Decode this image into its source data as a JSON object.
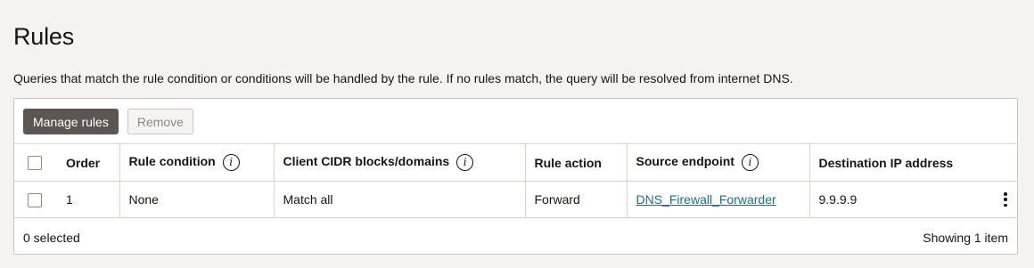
{
  "page": {
    "title": "Rules",
    "description": "Queries that match the rule condition or conditions will be handled by the rule. If no rules match, the query will be resolved from internet DNS."
  },
  "toolbar": {
    "manage_rules": "Manage rules",
    "remove": "Remove"
  },
  "table": {
    "columns": [
      {
        "label": "Order",
        "info": false
      },
      {
        "label": "Rule condition",
        "info": true
      },
      {
        "label": "Client CIDR blocks/domains",
        "info": true
      },
      {
        "label": "Rule action",
        "info": false
      },
      {
        "label": "Source endpoint",
        "info": true
      },
      {
        "label": "Destination IP address",
        "info": false
      }
    ],
    "info_glyph": "i",
    "rows": [
      {
        "order": "1",
        "condition": "None",
        "cidr": "Match all",
        "action": "Forward",
        "source_endpoint": "DNS_Firewall_Forwarder",
        "destination_ip": "9.9.9.9"
      }
    ]
  },
  "footer": {
    "selected": "0 selected",
    "showing": "Showing 1 item"
  }
}
